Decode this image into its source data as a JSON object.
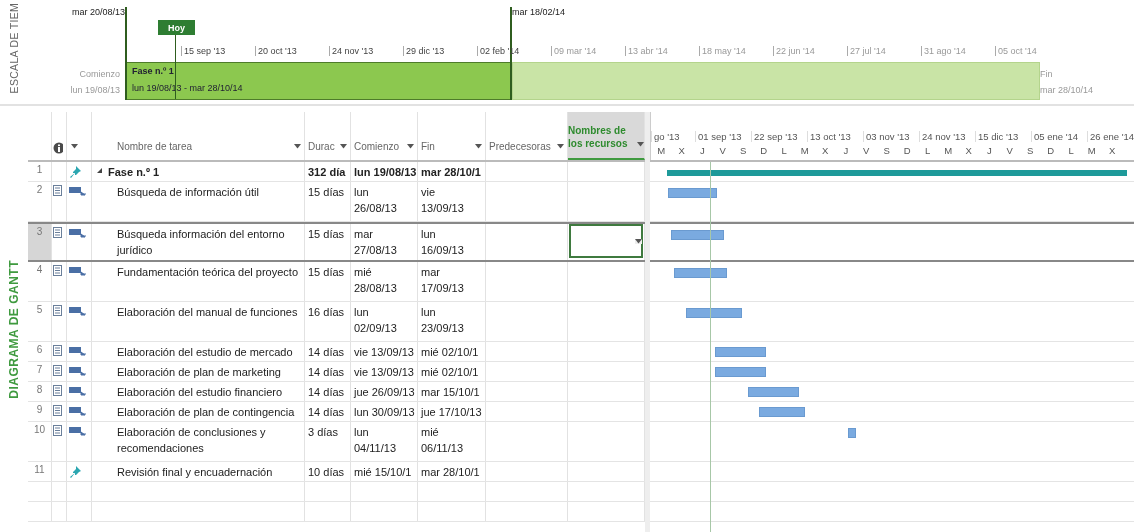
{
  "timeline": {
    "side_label": "ESCALA DE TIEM",
    "view_start": "mar 20/08/13",
    "view_end": "mar 18/02/14",
    "today": "Hoy",
    "ticks": [
      "15 sep '13",
      "20 oct '13",
      "24 nov '13",
      "29 dic '13",
      "02 feb '14",
      "09 mar '14",
      "13 abr '14",
      "18 may '14",
      "22 jun '14",
      "27 jul '14",
      "31 ago '14",
      "05 oct '14"
    ],
    "start_label": "Comienzo",
    "start_date": "lun 19/08/13",
    "end_label": "Fin",
    "end_date": "mar 28/10/14",
    "bar": {
      "name": "Fase n.º 1",
      "dates": "lun 19/08/13 - mar 28/10/14"
    }
  },
  "gantt_view": {
    "side_label": "DIAGRAMA DE GANTT",
    "columns": [
      {
        "kind": "name",
        "label": "Nombre de tarea",
        "highlighted": false
      },
      {
        "kind": "duration",
        "label": "Durac",
        "highlighted": false
      },
      {
        "kind": "start",
        "label": "Comienzo",
        "highlighted": false
      },
      {
        "kind": "finish",
        "label": "Fin",
        "highlighted": false
      },
      {
        "kind": "predecessors",
        "label": "Predecesoras",
        "highlighted": false
      },
      {
        "kind": "resources",
        "label": "Nombres de los recursos",
        "highlighted": true
      }
    ],
    "tasks": [
      {
        "id": "1",
        "kind": "manual",
        "summary": true,
        "expanded": true,
        "name": "Fase n.º 1",
        "duration": "312 día",
        "start": "lun 19/08/13",
        "finish": "mar 28/10/1",
        "wrapped": false,
        "selected": false
      },
      {
        "id": "2",
        "kind": "auto",
        "summary": false,
        "name": "Búsqueda de información útil",
        "duration": "15 días",
        "start": "lun 26/08/13",
        "finish": "vie 13/09/13",
        "wrapped": true,
        "selected": false
      },
      {
        "id": "3",
        "kind": "auto",
        "summary": false,
        "name": "Búsqueda información del entorno jurídico",
        "duration": "15 días",
        "start": "mar 27/08/13",
        "finish": "lun 16/09/13",
        "wrapped": true,
        "selected": true
      },
      {
        "id": "4",
        "kind": "auto",
        "summary": false,
        "name": "Fundamentación teórica del proyecto",
        "duration": "15 días",
        "start": "mié 28/08/13",
        "finish": "mar 17/09/13",
        "wrapped": true,
        "selected": false
      },
      {
        "id": "5",
        "kind": "auto",
        "summary": false,
        "name": "Elaboración del manual de funciones",
        "duration": "16 días",
        "start": "lun 02/09/13",
        "finish": "lun 23/09/13",
        "wrapped": true,
        "selected": false
      },
      {
        "id": "6",
        "kind": "auto",
        "summary": false,
        "name": "Elaboración del estudio de mercado",
        "duration": "14 días",
        "start": "vie 13/09/13",
        "finish": "mié 02/10/1",
        "wrapped": false,
        "selected": false
      },
      {
        "id": "7",
        "kind": "auto",
        "summary": false,
        "name": "Elaboración de plan de marketing",
        "duration": "14 días",
        "start": "vie 13/09/13",
        "finish": "mié 02/10/1",
        "wrapped": false,
        "selected": false
      },
      {
        "id": "8",
        "kind": "auto",
        "summary": false,
        "name": "Elaboración del estudio financiero",
        "duration": "14 días",
        "start": "jue 26/09/13",
        "finish": "mar 15/10/1",
        "wrapped": false,
        "selected": false
      },
      {
        "id": "9",
        "kind": "auto",
        "summary": false,
        "name": "Elaboración de plan de contingencia",
        "duration": "14 días",
        "start": "lun 30/09/13",
        "finish": "jue 17/10/13",
        "wrapped": false,
        "selected": false
      },
      {
        "id": "10",
        "kind": "auto",
        "summary": false,
        "name": "Elaboración de conclusiones y recomendaciones",
        "duration": "3 días",
        "start": "lun 04/11/13",
        "finish": "mié 06/11/13",
        "wrapped": true,
        "selected": false
      },
      {
        "id": "11",
        "kind": "manual",
        "summary": false,
        "name": "Revisión final y encuadernación",
        "duration": "10 días",
        "start": "mié 15/10/1",
        "finish": "mar 28/10/1",
        "wrapped": false,
        "selected": false
      }
    ],
    "chart": {
      "top_scale": [
        "go '13",
        "01 sep '13",
        "22 sep '13",
        "13 oct '13",
        "03 nov '13",
        "24 nov '13",
        "15 dic '13",
        "05 ene '14",
        "26 ene '14"
      ],
      "bottom_scale": [
        "M",
        "X",
        "J",
        "V",
        "S",
        "D",
        "L",
        "M",
        "X",
        "J",
        "V",
        "S",
        "D",
        "L",
        "M",
        "X",
        "J",
        "V",
        "S",
        "D",
        "L",
        "M",
        "X"
      ]
    }
  }
}
